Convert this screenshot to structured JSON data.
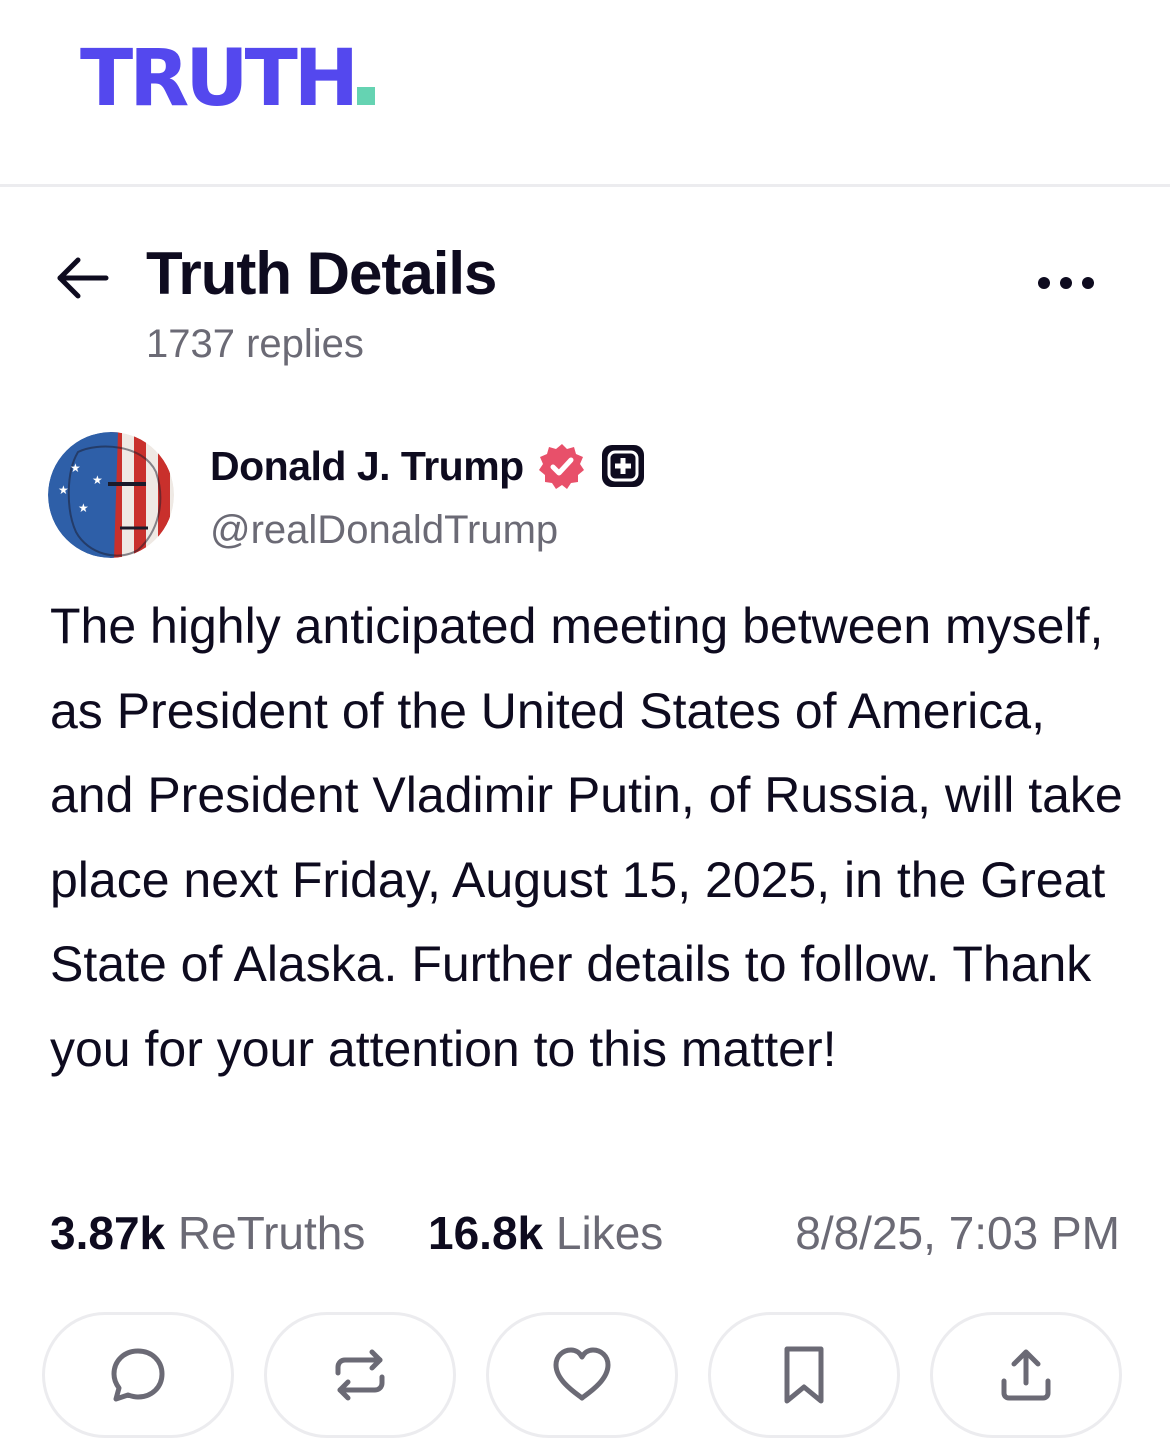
{
  "app": {
    "logo_text": "TRUTH",
    "brand_color": "#5448ee",
    "accent_dot_color": "#65d3b2"
  },
  "header": {
    "title": "Truth Details",
    "replies": "1737 replies",
    "back_icon": "arrow-left-icon",
    "more_icon": "more-horizontal-icon"
  },
  "post": {
    "author_name": "Donald J. Trump",
    "author_handle": "@realDonaldTrump",
    "verified_badge_color": "#e8506a",
    "badges": [
      "verified-badge-icon",
      "plus-badge-icon"
    ],
    "text": "The highly anticipated meeting between myself, as President of the United States of America, and President Vladimir Putin, of Russia, will take place next Friday, August 15, 2025, in the Great State of Alaska. Further details to follow. Thank you for your attention to this matter!",
    "retruths_count": "3.87k",
    "retruths_label": "ReTruths",
    "likes_count": "16.8k",
    "likes_label": "Likes",
    "timestamp": "8/8/25, 7:03 PM"
  },
  "actions": [
    {
      "name": "reply-button",
      "icon": "comment-icon"
    },
    {
      "name": "retruth-button",
      "icon": "repost-icon"
    },
    {
      "name": "like-button",
      "icon": "heart-icon"
    },
    {
      "name": "bookmark-button",
      "icon": "bookmark-icon"
    },
    {
      "name": "share-button",
      "icon": "share-icon"
    }
  ]
}
